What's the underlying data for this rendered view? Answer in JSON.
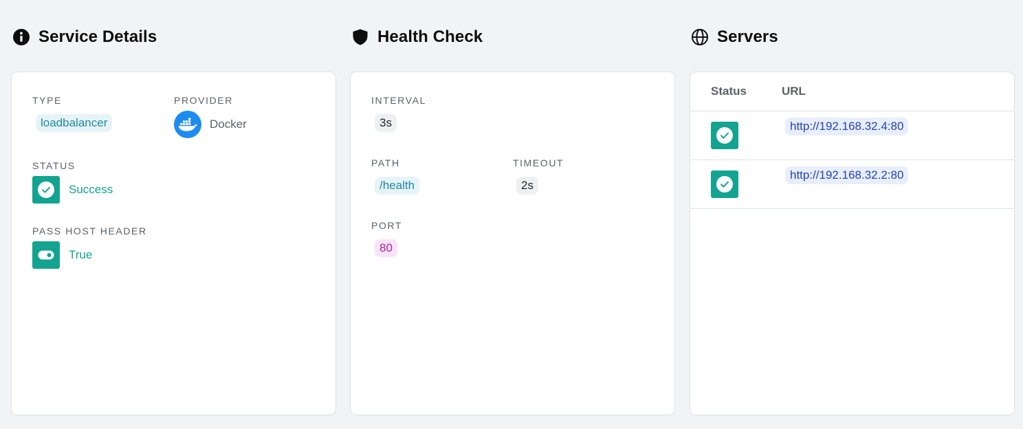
{
  "service_details": {
    "title": "Service Details",
    "icon": "info-icon",
    "type_label": "TYPE",
    "type_value": "loadbalancer",
    "provider_label": "PROVIDER",
    "provider_icon": "docker-icon",
    "provider_value": "Docker",
    "status_label": "STATUS",
    "status_value": "Success",
    "pass_host_header_label": "PASS HOST HEADER",
    "pass_host_header_value": "True"
  },
  "health_check": {
    "title": "Health Check",
    "icon": "shield-icon",
    "interval_label": "INTERVAL",
    "interval_value": "3s",
    "path_label": "PATH",
    "path_value": "/health",
    "timeout_label": "TIMEOUT",
    "timeout_value": "2s",
    "port_label": "PORT",
    "port_value": "80"
  },
  "servers": {
    "title": "Servers",
    "icon": "globe-icon",
    "columns": [
      "Status",
      "URL"
    ],
    "rows": [
      {
        "status_icon": "check-circle-icon",
        "url": "http://192.168.32.4:80"
      },
      {
        "status_icon": "check-circle-icon",
        "url": "http://192.168.32.2:80"
      }
    ]
  },
  "colors": {
    "success": "#12a490",
    "docker": "#1d8cf0",
    "background": "#f2f3f5"
  }
}
